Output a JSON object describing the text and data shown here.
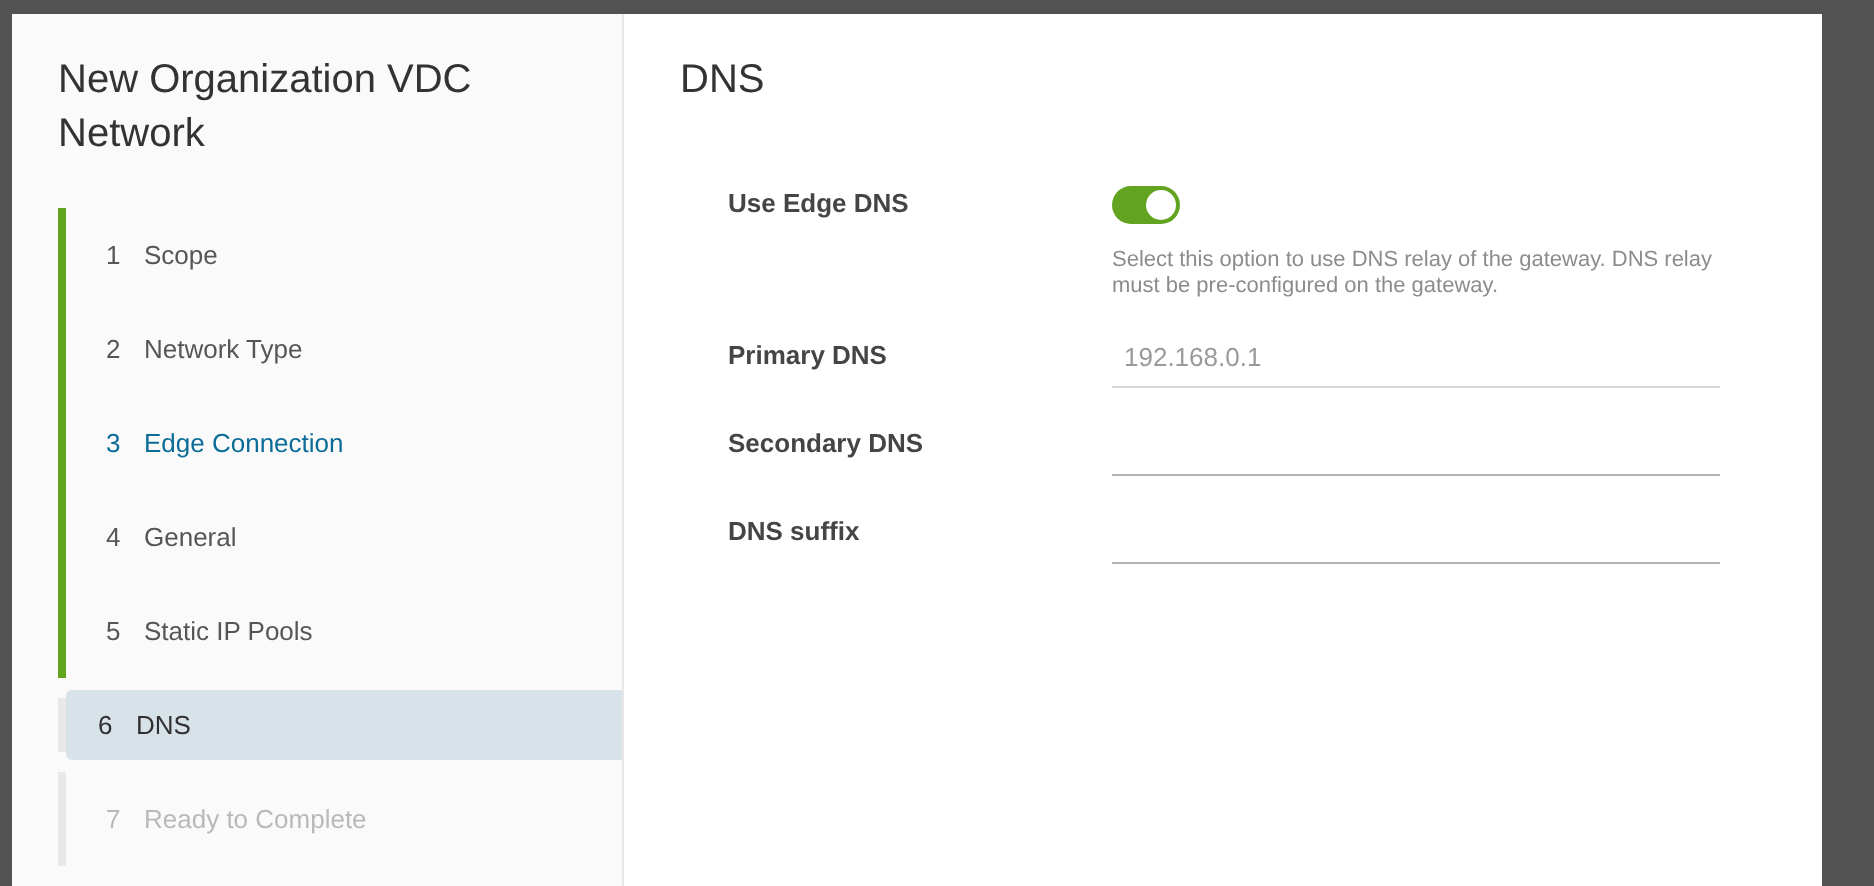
{
  "wizard": {
    "title": "New Organization VDC Network",
    "steps": [
      {
        "number": "1",
        "label": "Scope",
        "completed": true,
        "selected": false,
        "highlighted": false,
        "disabled": false
      },
      {
        "number": "2",
        "label": "Network Type",
        "completed": true,
        "selected": false,
        "highlighted": false,
        "disabled": false
      },
      {
        "number": "3",
        "label": "Edge Connection",
        "completed": true,
        "selected": false,
        "highlighted": true,
        "disabled": false
      },
      {
        "number": "4",
        "label": "General",
        "completed": true,
        "selected": false,
        "highlighted": false,
        "disabled": false
      },
      {
        "number": "5",
        "label": "Static IP Pools",
        "completed": true,
        "selected": false,
        "highlighted": false,
        "disabled": false
      },
      {
        "number": "6",
        "label": "DNS",
        "completed": false,
        "selected": true,
        "highlighted": false,
        "disabled": false
      },
      {
        "number": "7",
        "label": "Ready to Complete",
        "completed": false,
        "selected": false,
        "highlighted": false,
        "disabled": true
      }
    ]
  },
  "page": {
    "title": "DNS",
    "fields": [
      {
        "kind": "toggle",
        "label": "Use Edge DNS",
        "on": true,
        "help": "Select this option to use DNS relay of the gateway. DNS relay must be pre-configured on the gateway."
      },
      {
        "kind": "text",
        "label": "Primary DNS",
        "value": "192.168.0.1",
        "disabled": true
      },
      {
        "kind": "text",
        "label": "Secondary DNS",
        "disabled": false
      },
      {
        "kind": "text",
        "label": "DNS suffix",
        "disabled": false
      }
    ]
  }
}
